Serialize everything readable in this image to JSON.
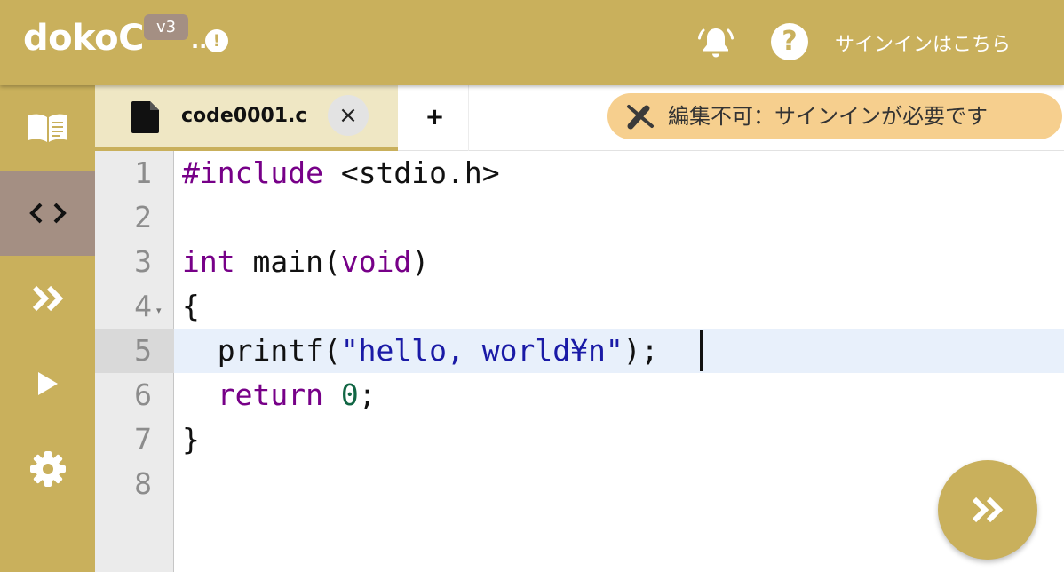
{
  "header": {
    "logo": "dokoC",
    "version": "v3",
    "alert_dots": "..",
    "alert_mark": "!",
    "help_mark": "?",
    "signin_label": "サインインはこちら"
  },
  "sidebar": {
    "items": [
      {
        "name": "book",
        "icon": "book-open-icon",
        "active": false
      },
      {
        "name": "code",
        "icon": "code-brackets-icon",
        "active": true
      },
      {
        "name": "next",
        "icon": "double-chevron-right-icon",
        "active": false
      },
      {
        "name": "run",
        "icon": "play-icon",
        "active": false
      },
      {
        "name": "settings",
        "icon": "gear-icon",
        "active": false
      }
    ]
  },
  "tabs": {
    "active": {
      "title": "code0001.c",
      "close_label": "×"
    },
    "add_label": "+"
  },
  "readonly_notice": "編集不可：サインインが必要です",
  "editor": {
    "current_line": 5,
    "lines": [
      {
        "number": "1",
        "text": "#include <stdio.h>"
      },
      {
        "number": "2",
        "text": ""
      },
      {
        "number": "3",
        "text": "int main(void)"
      },
      {
        "number": "4",
        "text": "{"
      },
      {
        "number": "5",
        "text": "  printf(\"hello, world¥n\");"
      },
      {
        "number": "6",
        "text": "  return 0;"
      },
      {
        "number": "7",
        "text": "}"
      },
      {
        "number": "8",
        "text": ""
      }
    ]
  },
  "colors": {
    "brand": "#c9b05c",
    "sidebar_active": "#a48f83",
    "tab_active_bg": "#efe7c4",
    "notice_bg": "#f6cf8e",
    "keyword": "#770088",
    "string": "#1a1aa6",
    "number": "#116644"
  }
}
